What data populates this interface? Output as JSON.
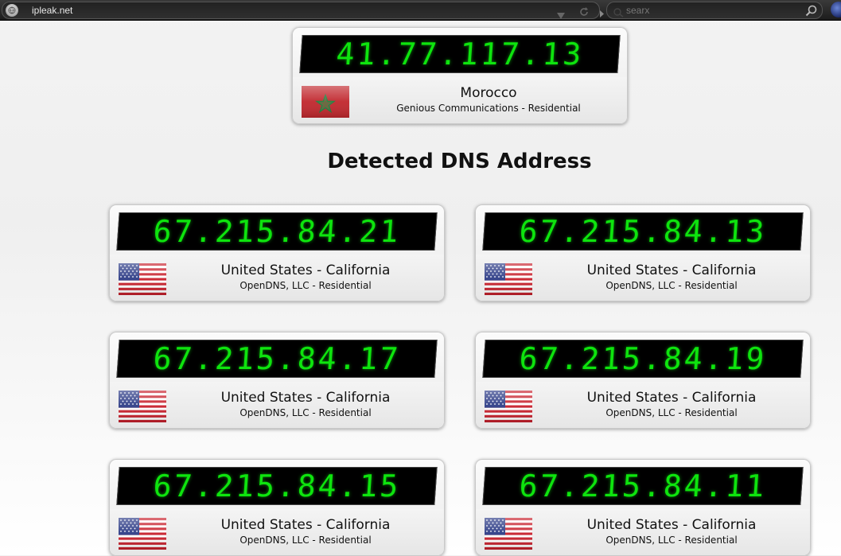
{
  "browser": {
    "url": "ipleak.net",
    "search_placeholder": "searx"
  },
  "your_ip": {
    "ip": "41.77.117.13",
    "country": "Morocco",
    "isp": "Genious Communications - Residential",
    "flag": "morocco-flag"
  },
  "dns_section": {
    "title": "Detected DNS Address"
  },
  "dns_servers": [
    {
      "ip": "67.215.84.21",
      "country": "United States - California",
      "isp": "OpenDNS, LLC - Residential",
      "flag": "usa-flag"
    },
    {
      "ip": "67.215.84.13",
      "country": "United States - California",
      "isp": "OpenDNS, LLC - Residential",
      "flag": "usa-flag"
    },
    {
      "ip": "67.215.84.17",
      "country": "United States - California",
      "isp": "OpenDNS, LLC - Residential",
      "flag": "usa-flag"
    },
    {
      "ip": "67.215.84.19",
      "country": "United States - California",
      "isp": "OpenDNS, LLC - Residential",
      "flag": "usa-flag"
    },
    {
      "ip": "67.215.84.15",
      "country": "United States - California",
      "isp": "OpenDNS, LLC - Residential",
      "flag": "usa-flag"
    },
    {
      "ip": "67.215.84.11",
      "country": "United States - California",
      "isp": "OpenDNS, LLC - Residential",
      "flag": "usa-flag"
    }
  ],
  "colors": {
    "lcd_digits": "#0ee40e",
    "lcd_background": "#000000"
  }
}
